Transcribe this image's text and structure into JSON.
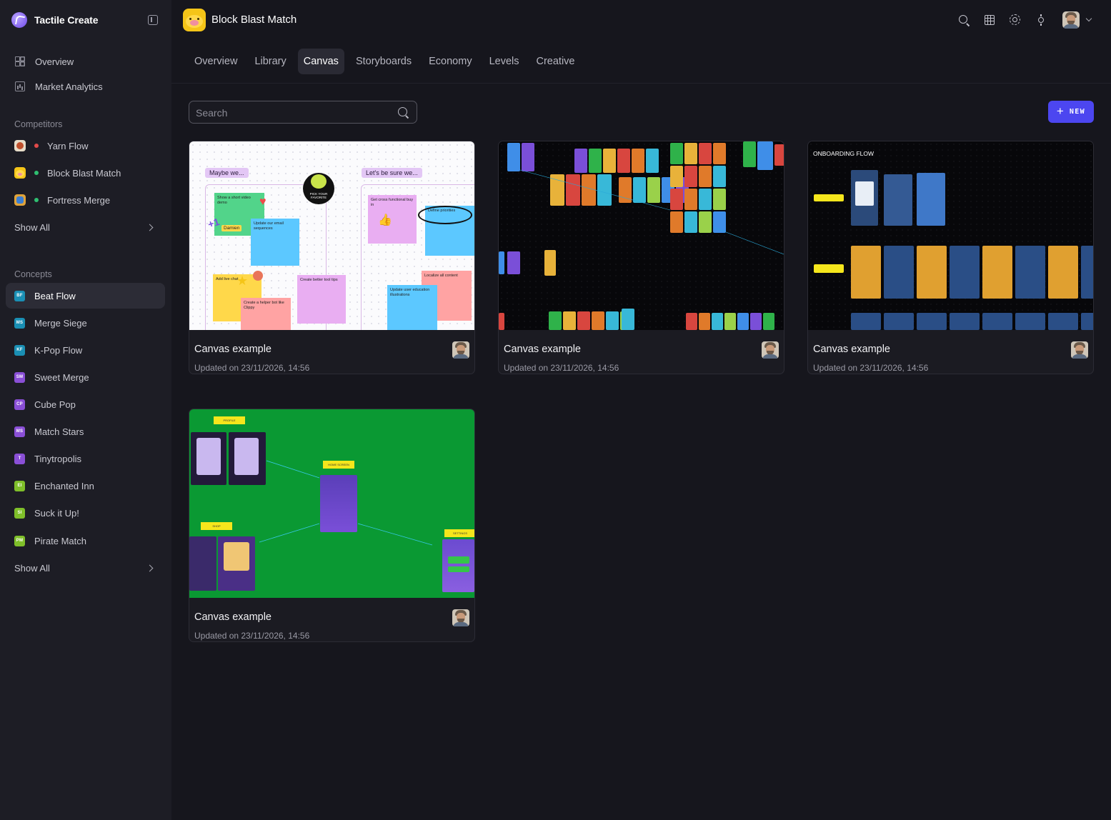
{
  "sidebar": {
    "brand": "Tactile Create",
    "nav": [
      {
        "label": "Overview"
      },
      {
        "label": "Market Analytics"
      }
    ],
    "competitors_label": "Competitors",
    "competitors": [
      {
        "label": "Yarn Flow",
        "dot_color": "#e24a4a"
      },
      {
        "label": "Block Blast Match",
        "dot_color": "#2fbf71"
      },
      {
        "label": "Fortress Merge",
        "dot_color": "#2fbf71"
      }
    ],
    "competitors_show_all": "Show All",
    "concepts_label": "Concepts",
    "concepts": [
      {
        "badge": "BF",
        "label": "Beat Flow",
        "color": "#1a8fb4",
        "active": true
      },
      {
        "badge": "MS",
        "label": "Merge Siege",
        "color": "#1a8fb4"
      },
      {
        "badge": "KF",
        "label": "K-Pop Flow",
        "color": "#1a8fb4"
      },
      {
        "badge": "SM",
        "label": "Sweet Merge",
        "color": "#8a4fd6"
      },
      {
        "badge": "CP",
        "label": "Cube Pop",
        "color": "#8a4fd6"
      },
      {
        "badge": "MS",
        "label": "Match Stars",
        "color": "#8a4fd6"
      },
      {
        "badge": "T",
        "label": "Tinytropolis",
        "color": "#8a4fd6"
      },
      {
        "badge": "EI",
        "label": "Enchanted Inn",
        "color": "#7fbf2a"
      },
      {
        "badge": "SI",
        "label": "Suck it Up!",
        "color": "#7fbf2a"
      },
      {
        "badge": "PM",
        "label": "Pirate Match",
        "color": "#7fbf2a"
      }
    ],
    "concepts_show_all": "Show All"
  },
  "header": {
    "app_title": "Block Blast Match",
    "icons": [
      "search-icon",
      "table-icon",
      "gear-icon",
      "sun-icon"
    ]
  },
  "tabs": [
    {
      "label": "Overview"
    },
    {
      "label": "Library"
    },
    {
      "label": "Canvas",
      "active": true
    },
    {
      "label": "Storyboards"
    },
    {
      "label": "Economy"
    },
    {
      "label": "Levels"
    },
    {
      "label": "Creative"
    }
  ],
  "toolbar": {
    "search_placeholder": "Search",
    "new_label": "NEW",
    "new_icon": "+"
  },
  "cards": [
    {
      "title": "Canvas example",
      "updated": "Updated on 23/11/2026, 14:56",
      "thumb": "whiteboard"
    },
    {
      "title": "Canvas example",
      "updated": "Updated on 23/11/2026, 14:56",
      "thumb": "screens-dark"
    },
    {
      "title": "Canvas example",
      "updated": "Updated on 23/11/2026, 14:56",
      "thumb": "onboarding-flow"
    },
    {
      "title": "Canvas example",
      "updated": "Updated on 23/11/2026, 14:56",
      "thumb": "green-flow"
    }
  ],
  "thumb_text": {
    "wb_frame1": "Maybe we...",
    "wb_frame2": "Let's be sure we...",
    "wb_s1": "Show a short video demo",
    "wb_s2": "Update our email sequences",
    "wb_s3": "Add live chat",
    "wb_s4": "Create a helper bot like Clippy",
    "wb_s5": "Create better tool tips",
    "wb_s6": "Get cross functional buy in",
    "wb_s7": "Define priorities",
    "wb_s8": "Localize all content",
    "wb_s9": "Update user education illustrations",
    "wb_name": "Damien",
    "wb_sticker": "PICK YOUR FAVORITE",
    "wb_plus": "+1",
    "ob_title": "ONBOARDING FLOW",
    "gr_profile": "PROFILE",
    "gr_home": "HOME SCREEN",
    "gr_shop": "SHOP",
    "gr_settings": "SETTINGS"
  }
}
